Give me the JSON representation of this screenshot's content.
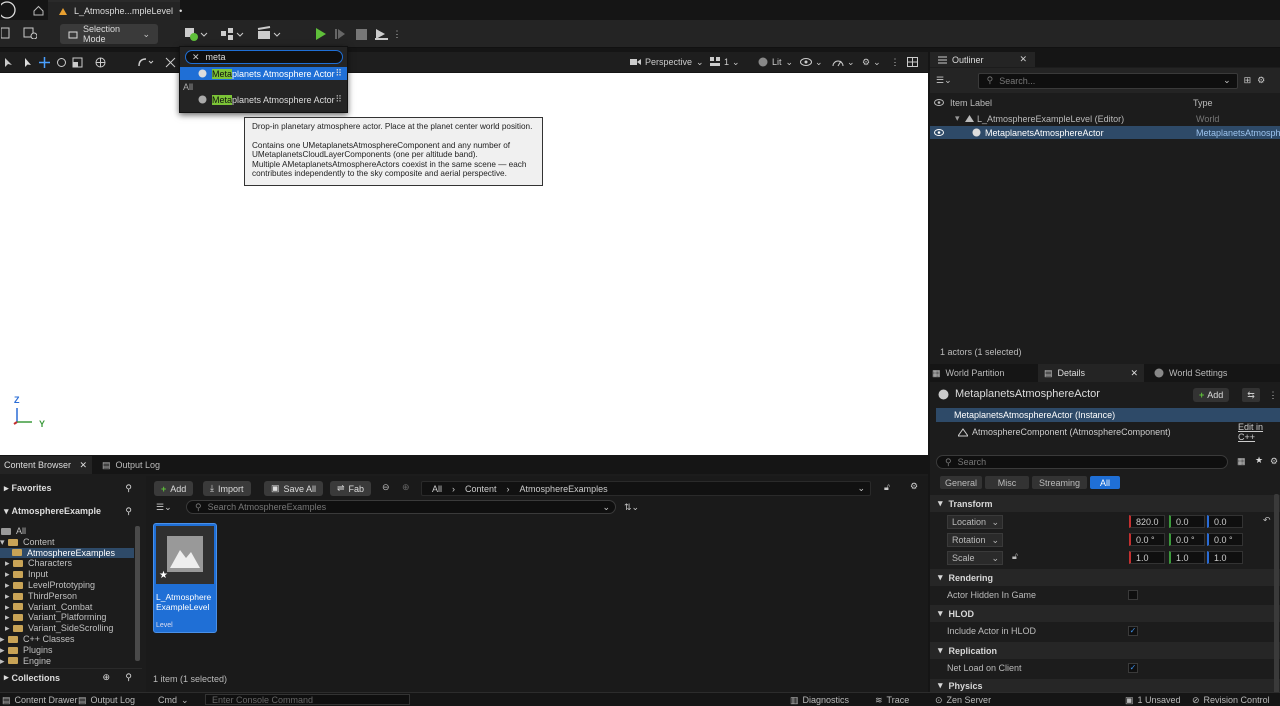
{
  "app": {
    "level_tab": "L_Atmosphe...mpleLevel",
    "modified_marker": "•"
  },
  "toolbar": {
    "selection_mode": "Selection Mode"
  },
  "viewport": {
    "perspective": "Perspective",
    "lit": "Lit",
    "grid_count": "1",
    "axis_z": "Z",
    "axis_y": "Y"
  },
  "dropdown": {
    "query": "meta",
    "results": [
      {
        "match": "Meta",
        "rest": "planets Atmosphere Actor",
        "selected": true
      }
    ],
    "section": "All",
    "all_results": [
      {
        "match": "Meta",
        "rest": "planets Atmosphere Actor"
      }
    ]
  },
  "tooltip": {
    "line1": "Drop-in planetary atmosphere actor. Place at the planet center world position.",
    "line2": "Contains one UMetaplanetsAtmosphereComponent and any number of",
    "line3": "UMetaplanetsCloudLayerComponents (one per altitude band).",
    "line4": "Multiple AMetaplanetsAtmosphereActors coexist in the same scene — each",
    "line5": "contributes independently to the sky composite and aerial perspective."
  },
  "outliner": {
    "tab": "Outliner",
    "search_placeholder": "Search...",
    "col_label": "Item Label",
    "col_type": "Type",
    "rows": [
      {
        "label": "L_AtmosphereExampleLevel (Editor)",
        "type": "World"
      },
      {
        "label": "MetaplanetsAtmosphereActor",
        "type": "MetaplanetsAtmosph"
      }
    ],
    "footer": "1 actors (1 selected)"
  },
  "details": {
    "tabs": [
      "World Partition",
      "Details",
      "World Settings"
    ],
    "actor_name": "MetaplanetsAtmosphereActor",
    "add_label": "Add",
    "instance": "MetaplanetsAtmosphereActor (Instance)",
    "component": "AtmosphereComponent (AtmosphereComponent)",
    "edit_cpp": "Edit in C++",
    "search_placeholder": "Search",
    "filters": [
      "General",
      "Misc",
      "Streaming",
      "All"
    ],
    "sections": {
      "transform": "Transform",
      "rendering": "Rendering",
      "hlod": "HLOD",
      "replication": "Replication",
      "physics": "Physics"
    },
    "location": {
      "label": "Location",
      "x": "820.0",
      "y": "0.0",
      "z": "0.0"
    },
    "rotation": {
      "label": "Rotation",
      "x": "0.0 °",
      "y": "0.0 °",
      "z": "0.0 °"
    },
    "scale": {
      "label": "Scale",
      "x": "1.0",
      "y": "1.0",
      "z": "1.0"
    },
    "actor_hidden": "Actor Hidden In Game",
    "include_hlod": "Include Actor in HLOD",
    "net_load": "Net Load on Client"
  },
  "content_browser": {
    "tab": "Content Browser",
    "output_tab": "Output Log",
    "favorites": "Favorites",
    "project": "AtmosphereExample",
    "collections": "Collections",
    "tree": [
      "All",
      "Content",
      "AtmosphereExamples",
      "Characters",
      "Input",
      "LevelPrototyping",
      "ThirdPerson",
      "Variant_Combat",
      "Variant_Platforming",
      "Variant_SideScrolling",
      "C++ Classes",
      "Plugins",
      "Engine"
    ],
    "add": "Add",
    "import": "Import",
    "save_all": "Save All",
    "fab": "Fab",
    "path": [
      "All",
      "Content",
      "AtmosphereExamples"
    ],
    "search_placeholder": "Search AtmosphereExamples",
    "asset_name_1": "L_Atmosphere",
    "asset_name_2": "ExampleLevel",
    "asset_type": "Level",
    "footer": "1 item (1 selected)"
  },
  "statusbar": {
    "content_drawer": "Content Drawer",
    "output_log": "Output Log",
    "cmd": "Cmd",
    "console_placeholder": "Enter Console Command",
    "diagnostics": "Diagnostics",
    "trace": "Trace",
    "derived": "Zen Server",
    "unsaved": "1 Unsaved",
    "revision": "Revision Control"
  },
  "colors": {
    "accent": "#1f6fd6",
    "highlight": "#7cc437",
    "play": "#5fbf3a"
  }
}
